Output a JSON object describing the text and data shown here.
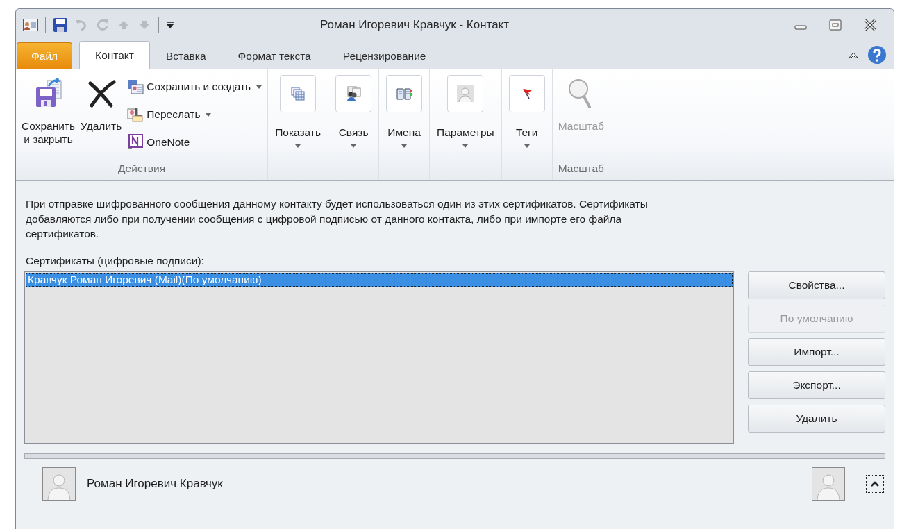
{
  "window": {
    "title": "Роман Игоревич Кравчук  -  Контакт"
  },
  "tabs": [
    {
      "label": "Файл",
      "kind": "file",
      "selected": false
    },
    {
      "label": "Контакт",
      "kind": "tab",
      "selected": true
    },
    {
      "label": "Вставка",
      "kind": "tab",
      "selected": false
    },
    {
      "label": "Формат текста",
      "kind": "tab",
      "selected": false
    },
    {
      "label": "Рецензирование",
      "kind": "tab",
      "selected": false
    }
  ],
  "ribbon": {
    "groups": [
      {
        "label": "Действия",
        "buttons": [
          {
            "kind": "large",
            "label": "Сохранить и закрыть",
            "dropdown": false,
            "disabled": false
          },
          {
            "kind": "large",
            "label": "Удалить",
            "dropdown": false,
            "disabled": false
          },
          {
            "kind": "small",
            "label": "Сохранить и создать",
            "dropdown": true,
            "disabled": false
          },
          {
            "kind": "small",
            "label": "Переслать",
            "dropdown": true,
            "disabled": false
          },
          {
            "kind": "small",
            "label": "OneNote",
            "dropdown": false,
            "disabled": false
          }
        ]
      },
      {
        "buttons": [
          {
            "kind": "box",
            "label": "Показать",
            "dropdown": true,
            "disabled": false
          }
        ]
      },
      {
        "buttons": [
          {
            "kind": "box",
            "label": "Связь",
            "dropdown": true,
            "disabled": false
          }
        ]
      },
      {
        "buttons": [
          {
            "kind": "box",
            "label": "Имена",
            "dropdown": true,
            "disabled": false
          }
        ]
      },
      {
        "buttons": [
          {
            "kind": "box",
            "label": "Параметры",
            "dropdown": true,
            "disabled": false
          }
        ]
      },
      {
        "buttons": [
          {
            "kind": "box",
            "label": "Теги",
            "dropdown": true,
            "disabled": false
          }
        ]
      },
      {
        "label": "Масштаб",
        "buttons": [
          {
            "kind": "large",
            "label": "Масштаб",
            "dropdown": false,
            "disabled": true
          }
        ]
      }
    ]
  },
  "content": {
    "description": "При отправке шифрованного сообщения данному контакту будет использоваться один из этих сертификатов. Сертификаты добавляются либо при получении сообщения с цифровой подписью от данного контакта, либо при импорте его файла сертификатов.",
    "list_label": "Сертификаты (цифровые подписи):",
    "certificates": [
      {
        "name": "Кравчук Роман Игоревич (Mail)(По умолчанию)",
        "selected": true
      }
    ],
    "buttons": [
      {
        "label": "Свойства...",
        "disabled": false
      },
      {
        "label": "По умолчанию",
        "disabled": true
      },
      {
        "label": "Импорт...",
        "disabled": false
      },
      {
        "label": "Экспорт...",
        "disabled": false
      },
      {
        "label": "Удалить",
        "disabled": false
      }
    ]
  },
  "footer": {
    "name": "Роман Игоревич Кравчук"
  }
}
